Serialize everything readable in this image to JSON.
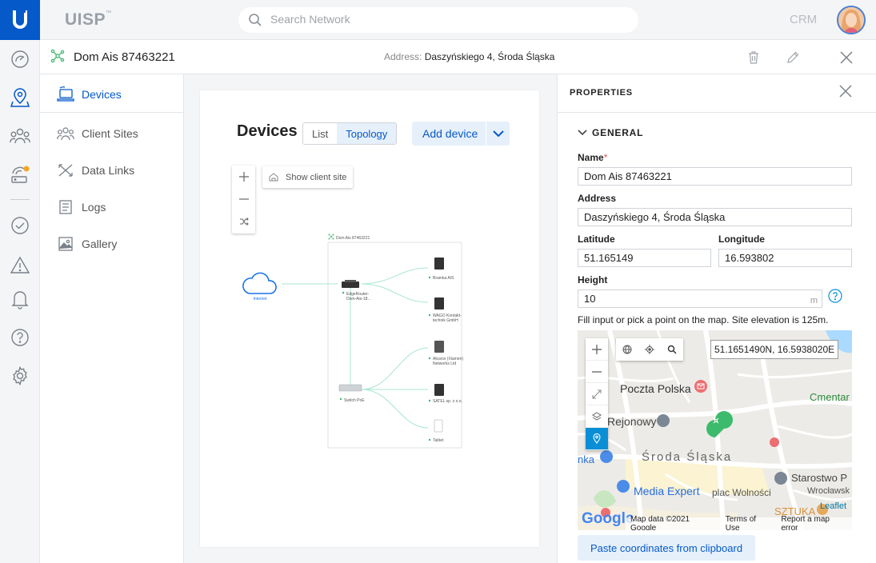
{
  "app": {
    "brand": "UISP",
    "brand_mark": "™",
    "crm": "CRM"
  },
  "search": {
    "placeholder": "Search Network"
  },
  "site": {
    "name": "Dom Ais 87463221",
    "address_label": "Address:",
    "address": "Daszyńskiego 4, Środa Śląska"
  },
  "nav": {
    "items": [
      {
        "label": "Devices",
        "icon": "devices-icon",
        "active": true
      },
      {
        "label": "Client Sites",
        "icon": "client-sites-icon"
      },
      {
        "label": "Data Links",
        "icon": "data-links-icon"
      },
      {
        "label": "Logs",
        "icon": "logs-icon"
      },
      {
        "label": "Gallery",
        "icon": "gallery-icon"
      }
    ]
  },
  "devices": {
    "title": "Devices",
    "view_list": "List",
    "view_topology": "Topology",
    "add_device": "Add device",
    "show_client_site": "Show client site"
  },
  "topology": {
    "site_label": "Dom Ais 87463221",
    "internet": "Internet",
    "router": [
      "EdgeRouter-",
      "Dom-Ais-18..."
    ],
    "switch": "Switch PoE",
    "endpoints": [
      {
        "label": [
          "Bramka AIS"
        ]
      },
      {
        "label": [
          "WAGO Kontakt-",
          "technik GmbH"
        ]
      },
      {
        "label": [
          "Akuvox (Xiamen)",
          "Networks Ltd"
        ]
      },
      {
        "label": [
          "SATEL sp. z o.o."
        ]
      },
      {
        "label": [
          "Tablet"
        ]
      }
    ],
    "colors": {
      "link": "#a8e6cf",
      "status": "#3dbb6c",
      "internet": "#1a73e8"
    }
  },
  "properties": {
    "title": "PROPERTIES",
    "section": "GENERAL",
    "name_label": "Name",
    "name_required": "*",
    "name_value": "Dom Ais 87463221",
    "address_label": "Address",
    "address_value": "Daszyńskiego 4, Środa Śląska",
    "latitude_label": "Latitude",
    "latitude_value": "51.165149",
    "longitude_label": "Longitude",
    "longitude_value": "16.593802",
    "height_label": "Height",
    "height_value": "10",
    "height_unit": "m",
    "hint": "Fill input or pick a point on the map. Site elevation is 125m.",
    "map_coords": "51.1651490N, 16.5938020E",
    "map_labels": {
      "poczta": "Poczta Polska",
      "cmentar": "Cmentar",
      "rejonowy": "Rejonowy",
      "nka": "nka",
      "city": "Środa Śląska",
      "starostwo": "Starostwo P",
      "wroclawsk": "Wrocławsk",
      "plac": "plac Wolności",
      "media": "Media Expert",
      "sztuka": "SZTUKA"
    },
    "leaflet": "Leaflet",
    "google": "Google",
    "attribution": [
      "Map data ©2021 Google",
      "Terms of Use",
      "Report a map error"
    ],
    "paste": "Paste coordinates from clipboard"
  }
}
